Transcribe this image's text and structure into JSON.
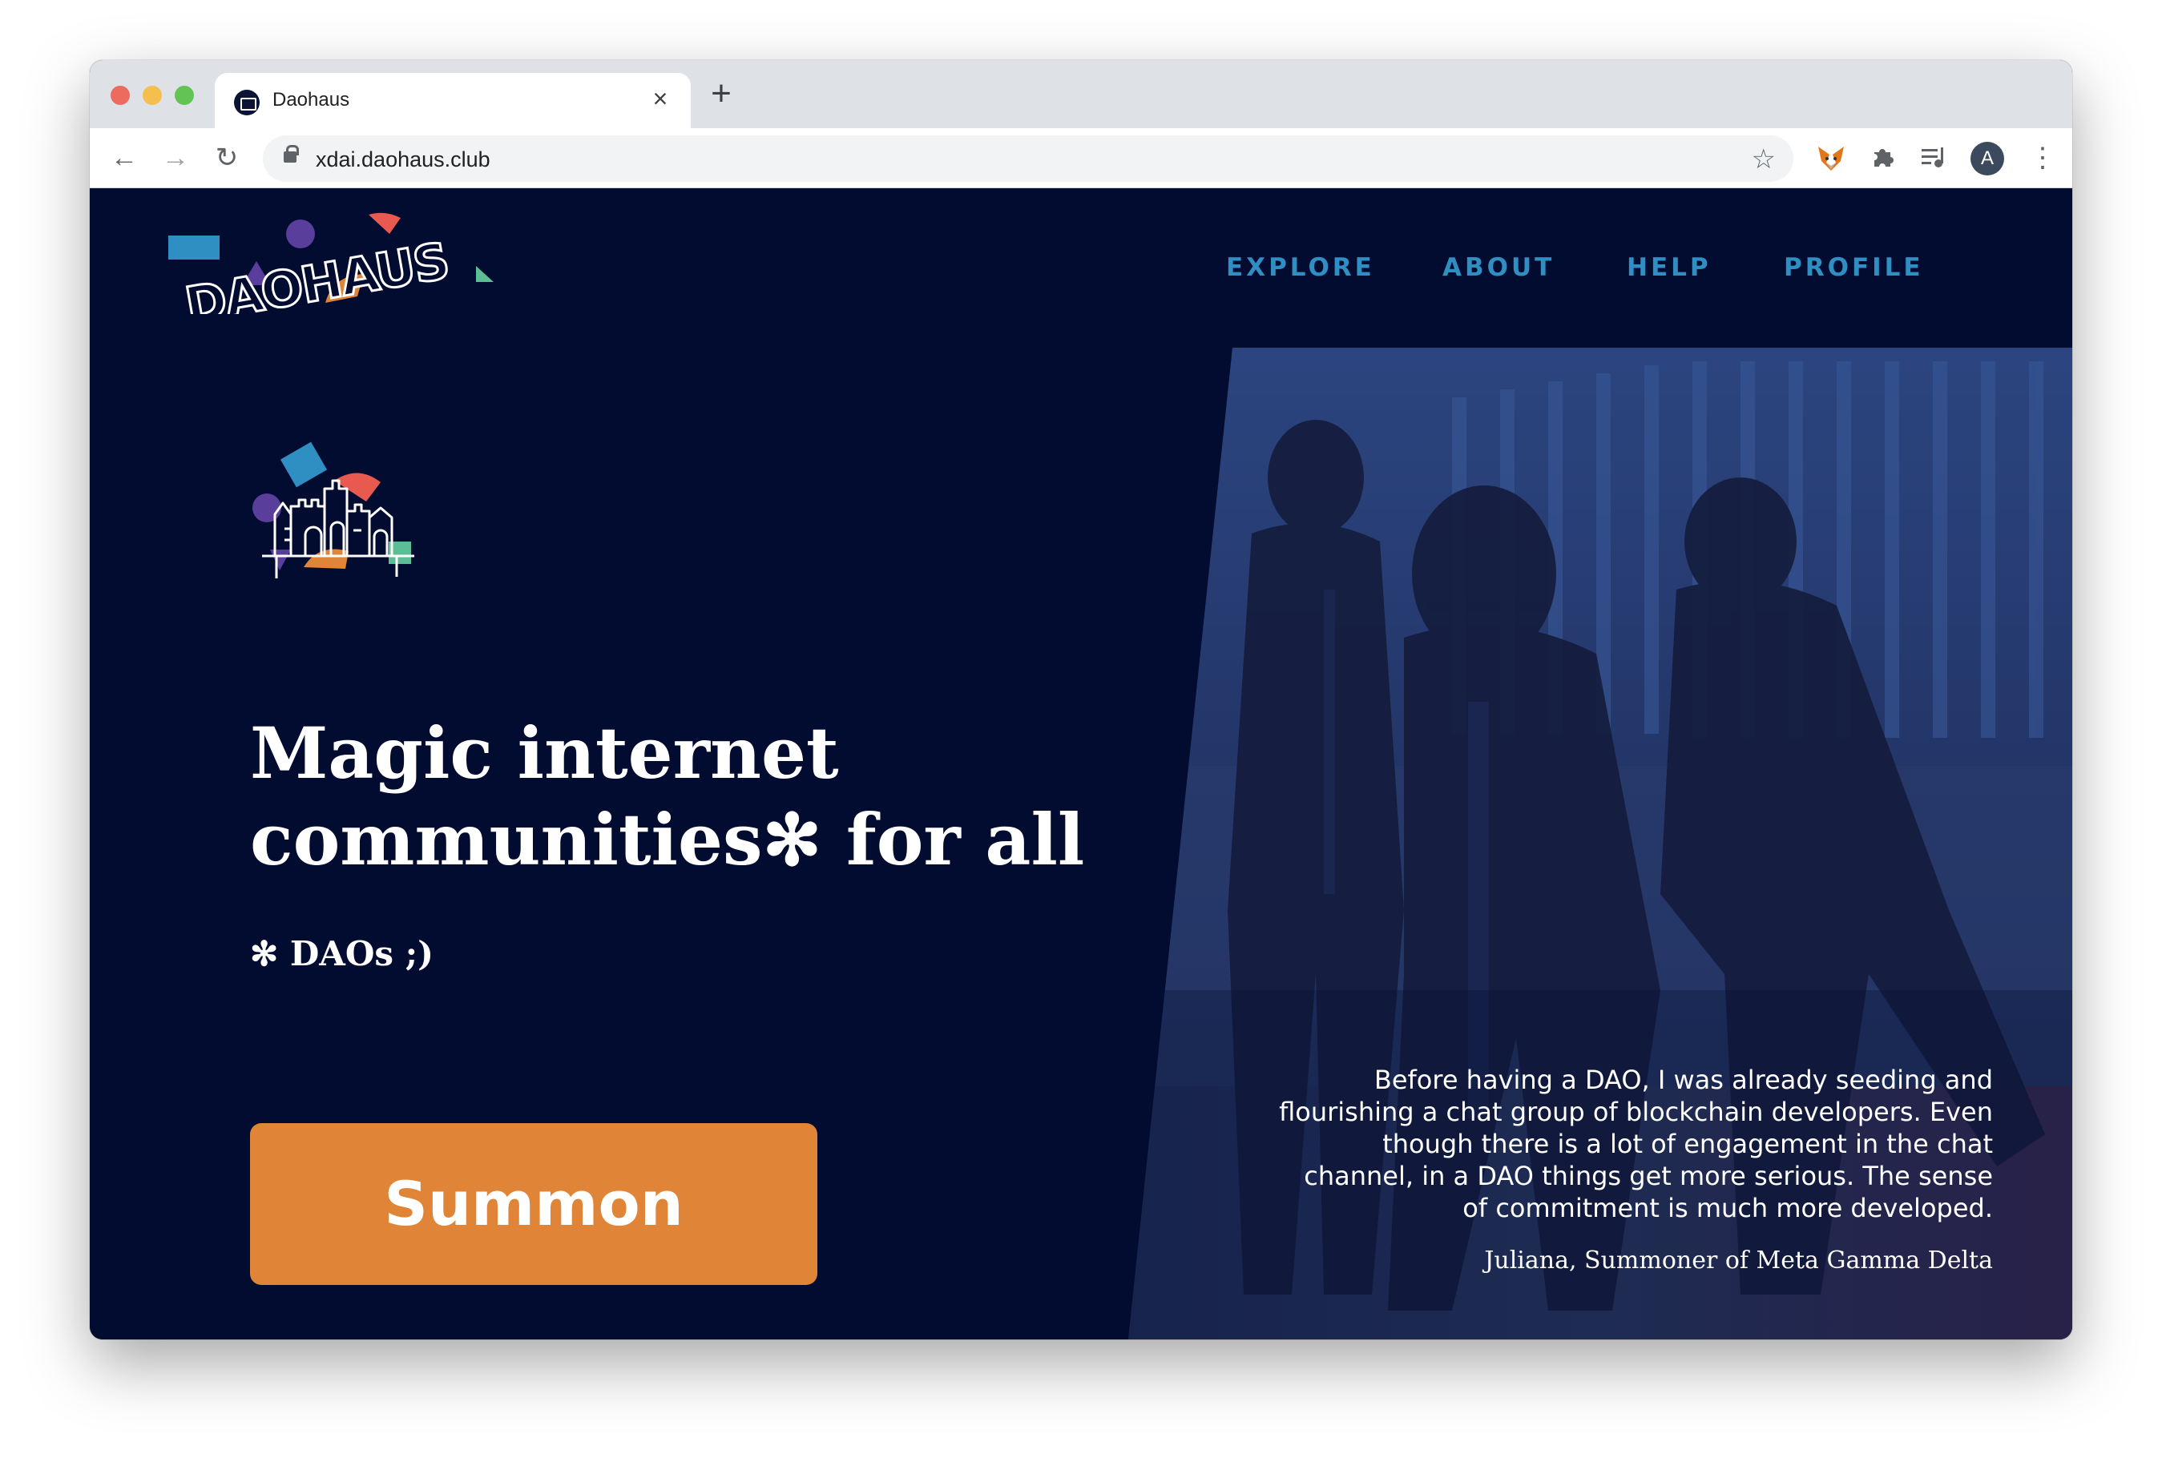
{
  "browser": {
    "tab_title": "Daohaus",
    "tab_close_icon": "close-icon",
    "new_tab_icon": "plus-icon",
    "url": "xdai.daohaus.club",
    "avatar_letter": "A",
    "extensions": [
      "metamask-fox-icon",
      "puzzle-icon",
      "media-queue-icon"
    ]
  },
  "site": {
    "logo_text": "DAOHAUS",
    "nav": {
      "explore": "EXPLORE",
      "about": "ABOUT",
      "help": "HELP",
      "profile": "PROFILE"
    },
    "hero": {
      "headline_line1": "Magic internet",
      "headline_line2": "communities✻ for all",
      "footnote": "✻ DAOs ;)",
      "cta_label": "Summon"
    },
    "testimonial": {
      "quote": "Before having a DAO, I was already seeding and flourishing a chat group of blockchain developers. Even though there is a lot of engagement in the chat channel, in a DAO things get more serious. The sense of commitment is much more developed.",
      "author": "Juliana, Summoner of Meta Gamma Delta"
    }
  },
  "colors": {
    "page_bg": "#020b30",
    "nav_accent": "#2f8ec2",
    "cta_orange": "#e08437",
    "logo_teal": "#2f8ec2",
    "logo_coral": "#e8594f",
    "logo_purple": "#5a3e9c",
    "logo_green": "#5bbf95"
  }
}
